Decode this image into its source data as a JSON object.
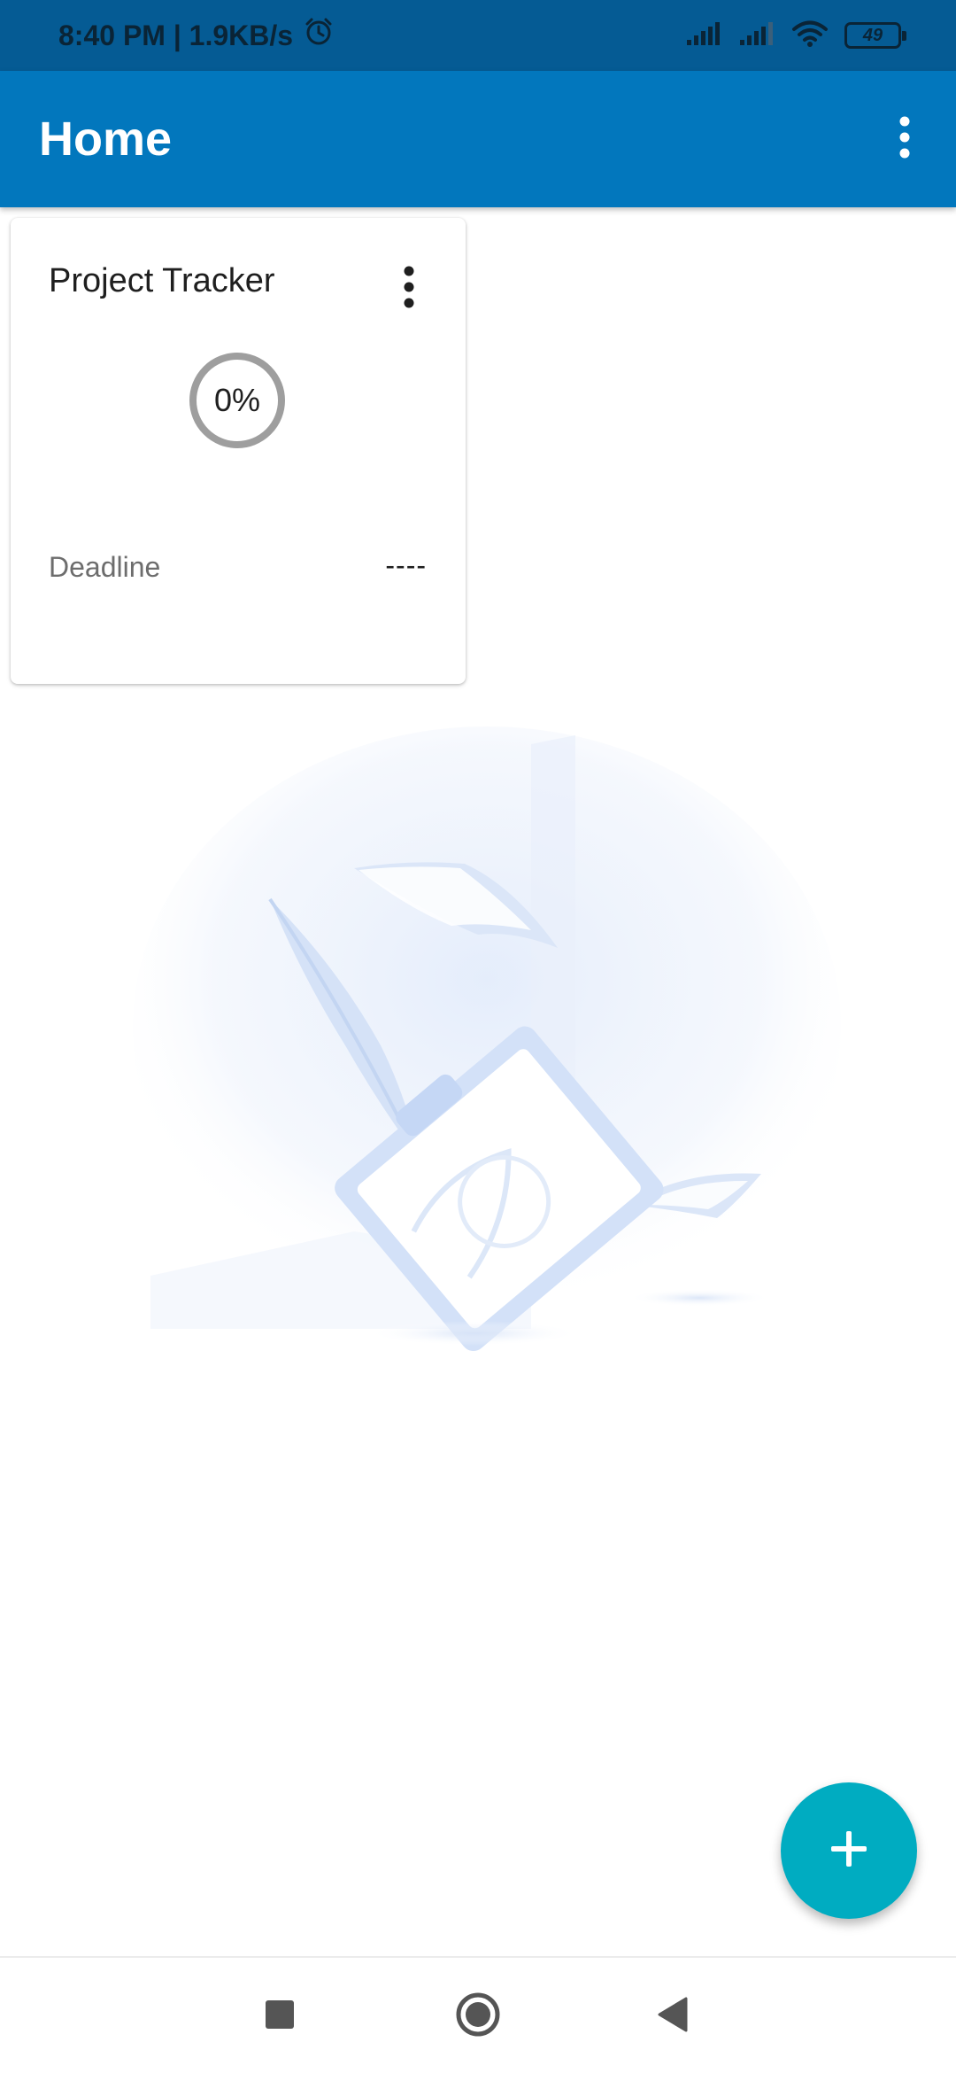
{
  "status_bar": {
    "time": "8:40 PM | 1.9KB/s",
    "battery_level": "49",
    "icons": [
      "alarm-icon",
      "signal-icon",
      "signal-icon",
      "wifi-icon",
      "battery-icon"
    ]
  },
  "app_bar": {
    "title": "Home",
    "overflow_icon": "more-vert-icon"
  },
  "projects": [
    {
      "name": "Project Tracker",
      "progress_label": "0%",
      "progress": 0,
      "deadline_label": "Deadline",
      "deadline_value": "----"
    }
  ],
  "fab": {
    "icon": "plus-icon"
  },
  "nav_bar": {
    "icons": [
      "recents-square-icon",
      "home-circle-icon",
      "back-triangle-icon"
    ]
  },
  "colors": {
    "status_bar": "#055b94",
    "app_bar": "#0277bd",
    "fab": "#00acc1",
    "progress_ring": "#9e9e9e",
    "illustration": "#cfe0f7"
  }
}
